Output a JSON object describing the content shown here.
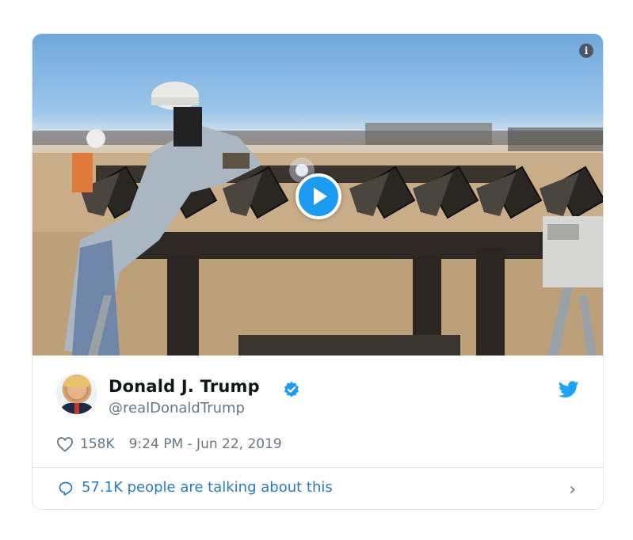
{
  "tweet": {
    "display_name": "Donald J. Trump",
    "handle": "@realDonaldTrump",
    "likes": "158K",
    "timestamp": "9:24 PM - Jun 22, 2019",
    "talking": "57.1K people are talking about this",
    "verified": true
  },
  "icons": {
    "info": "info-icon",
    "play": "play-icon",
    "verified": "verified-badge-icon",
    "brand": "twitter-bird-icon",
    "like": "heart-icon",
    "reply": "speech-bubble-icon",
    "more": "chevron-right-icon"
  },
  "colors": {
    "accent": "#1d9bf0",
    "link": "#2b7bb9",
    "secondary_text": "#657786",
    "border": "#e1e8ed"
  },
  "glyphs": {
    "info": "i",
    "chevron": "›"
  }
}
